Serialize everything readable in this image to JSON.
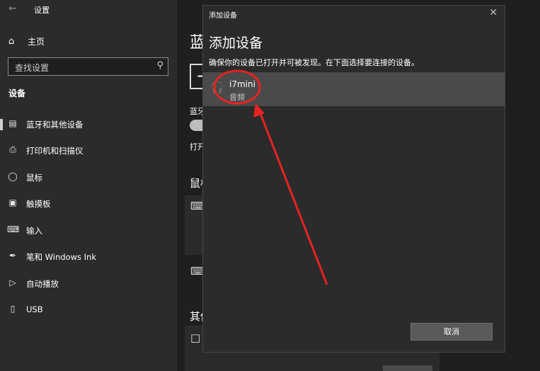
{
  "settings_window": {
    "title": "设置",
    "back_icon": "arrow-left-icon",
    "home": {
      "label": "主页",
      "icon": "home-icon"
    },
    "search": {
      "placeholder": "查找设置",
      "icon": "search-icon"
    },
    "section_label": "设备",
    "nav_items": [
      {
        "label": "蓝牙和其他设备",
        "icon": "bluetooth-devices-icon",
        "selected": true
      },
      {
        "label": "打印机和扫描仪",
        "icon": "printer-icon"
      },
      {
        "label": "鼠标",
        "icon": "mouse-icon"
      },
      {
        "label": "触摸板",
        "icon": "touchpad-icon"
      },
      {
        "label": "输入",
        "icon": "keyboard-icon"
      },
      {
        "label": "笔和 Windows Ink",
        "icon": "pen-icon"
      },
      {
        "label": "自动播放",
        "icon": "autoplay-icon"
      },
      {
        "label": "USB",
        "icon": "usb-icon"
      }
    ]
  },
  "content_peek": {
    "heading": "蓝",
    "add_symbol": "+",
    "bluetooth_label": "蓝牙",
    "open_label": "打开",
    "mouse_section": "鼠标",
    "other_section": "其他"
  },
  "dialog": {
    "window_title": "添加设备",
    "close_icon": "close-icon",
    "heading": "添加设备",
    "description": "确保你的设备已打开并可被发现。在下面选择要连接的设备。",
    "device": {
      "name": "i7mini",
      "type": "音频",
      "icon": "headset-icon"
    },
    "cancel_label": "取消"
  },
  "annotation": {
    "color": "#e52421"
  }
}
